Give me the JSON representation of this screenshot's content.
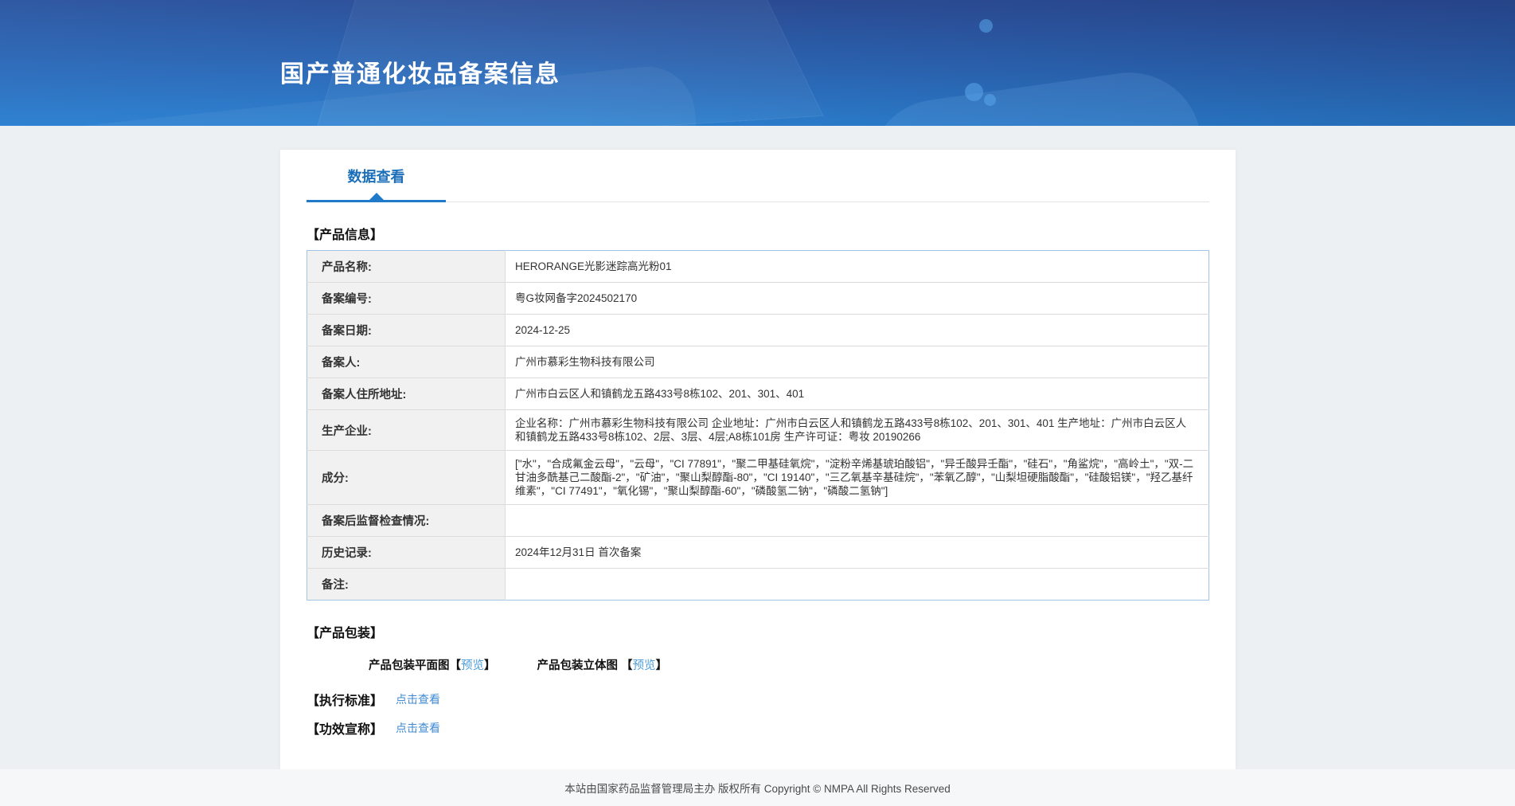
{
  "header": {
    "title": "国产普通化妆品备案信息"
  },
  "tabs": [
    {
      "label": "数据查看",
      "active": true
    }
  ],
  "product_info": {
    "heading": "【产品信息】",
    "rows": [
      {
        "label": "产品名称:",
        "value": "HERORANGE光影迷踪高光粉01"
      },
      {
        "label": "备案编号:",
        "value": "粤G妆网备字2024502170"
      },
      {
        "label": "备案日期:",
        "value": "2024-12-25"
      },
      {
        "label": "备案人:",
        "value": "广州市慕彩生物科技有限公司"
      },
      {
        "label": "备案人住所地址:",
        "value": "广州市白云区人和镇鹤龙五路433号8栋102、201、301、401"
      },
      {
        "label": "生产企业:",
        "value": "企业名称：广州市慕彩生物科技有限公司 企业地址：广州市白云区人和镇鹤龙五路433号8栋102、201、301、401 生产地址：广州市白云区人和镇鹤龙五路433号8栋102、2层、3层、4层;A8栋101房 生产许可证：粤妆 20190266"
      },
      {
        "label": "成分:",
        "value": "[\"水\"，\"合成氟金云母\"，\"云母\"，\"CI 77891\"，\"聚二甲基硅氧烷\"，\"淀粉辛烯基琥珀酸铝\"，\"异壬酸异壬酯\"，\"硅石\"，\"角鲨烷\"，\"高岭土\"，\"双-二甘油多酰基己二酸酯-2\"，\"矿油\"，\"聚山梨醇酯-80\"，\"CI 19140\"，\"三乙氧基辛基硅烷\"，\"苯氧乙醇\"，\"山梨坦硬脂酸酯\"，\"硅酸铝镁\"，\"羟乙基纤维素\"，\"CI 77491\"，\"氧化锡\"，\"聚山梨醇酯-60\"，\"磷酸氢二钠\"，\"磷酸二氢钠\"]"
      },
      {
        "label": "备案后监督检查情况:",
        "value": ""
      },
      {
        "label": "历史记录:",
        "value": "2024年12月31日 首次备案"
      },
      {
        "label": "备注:",
        "value": ""
      }
    ]
  },
  "packaging": {
    "heading": "【产品包装】",
    "items": [
      {
        "prefix": "产品包装平面图【",
        "link": "预览",
        "suffix": "】"
      },
      {
        "prefix": "产品包装立体图 【",
        "link": "预览",
        "suffix": "】"
      }
    ]
  },
  "standard": {
    "heading": "【执行标准】",
    "link": "点击查看"
  },
  "efficacy": {
    "heading": "【功效宣称】",
    "link": "点击查看"
  },
  "footer": {
    "text": "本站由国家药品监督管理局主办 版权所有 Copyright © NMPA All Rights Reserved"
  },
  "colors": {
    "tab_accent": "#1f7ac9",
    "tab_text": "#1b6fb9",
    "link_blue": "#3f8ad2",
    "preview_link_blue": "#4d9ddb",
    "table_border_blue": "#a3c3e3",
    "label_cell_gray": "#f1f1f1",
    "banner_top": "#2c4d96",
    "banner_bottom": "#2b80d0"
  }
}
